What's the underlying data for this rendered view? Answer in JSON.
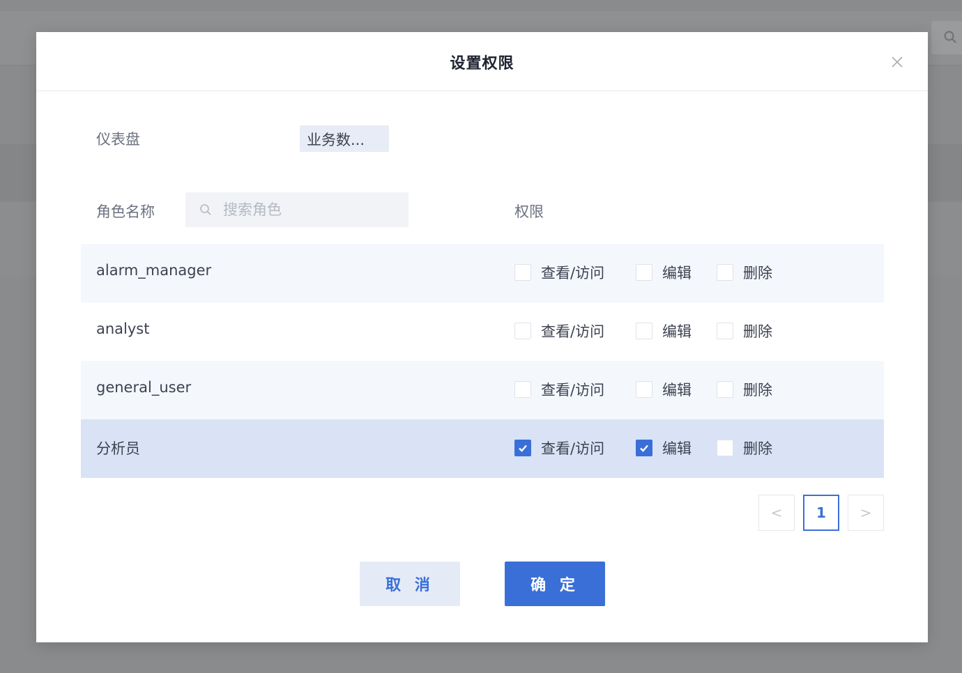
{
  "dialog": {
    "title": "设置权限",
    "dashboard_label": "仪表盘",
    "dashboard_value": "业务数...",
    "role_label": "角色名称",
    "search_placeholder": "搜索角色",
    "permission_label": "权限"
  },
  "permission_names": {
    "view": "查看/访问",
    "edit": "编辑",
    "delete": "删除"
  },
  "roles": [
    {
      "name": "alarm_manager",
      "view": false,
      "edit": false,
      "delete": false
    },
    {
      "name": "analyst",
      "view": false,
      "edit": false,
      "delete": false
    },
    {
      "name": "general_user",
      "view": false,
      "edit": false,
      "delete": false
    },
    {
      "name": "分析员",
      "view": true,
      "edit": true,
      "delete": false,
      "selected": true
    }
  ],
  "pagination": {
    "prev": "<",
    "current": "1",
    "next": ">"
  },
  "buttons": {
    "cancel": "取 消",
    "ok": "确 定"
  },
  "colors": {
    "accent": "#3a6fd8",
    "row_alt": "#f4f7fc",
    "row_selected": "#d9e3f5"
  },
  "icons": {
    "close": "close-icon",
    "search": "search-icon",
    "check": "check-icon"
  }
}
